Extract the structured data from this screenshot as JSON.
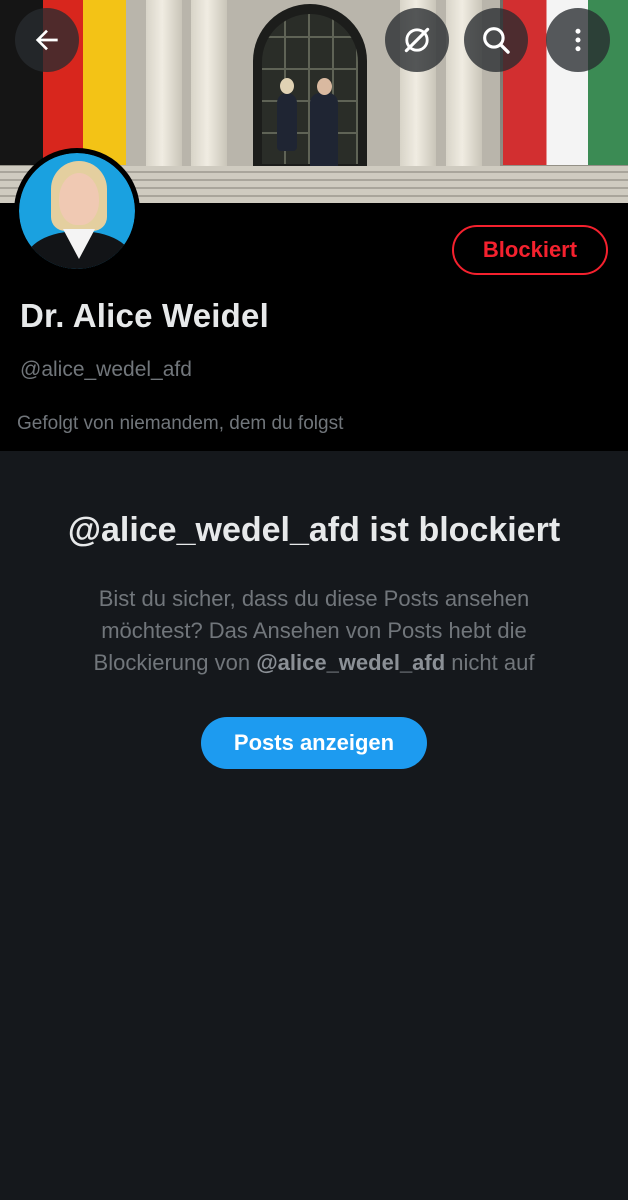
{
  "header": {
    "banner_alt": "Profile banner image",
    "back_icon": "arrow-left-icon",
    "grok_icon": "grok-icon",
    "search_icon": "search-icon",
    "more_icon": "more-vertical-icon"
  },
  "profile": {
    "display_name": "Dr. Alice Weidel",
    "handle": "@alice_wedel_afd",
    "followed_by": "Gefolgt von niemandem, dem du folgst",
    "blocked_button": "Blockiert"
  },
  "blocked_notice": {
    "title": "@alice_wedel_afd ist blockiert",
    "desc_before": "Bist du sicher, dass du diese Posts ansehen möchtest? Das Ansehen von Posts hebt die Blockierung von ",
    "desc_handle": "@alice_wedel_afd",
    "desc_after": " nicht auf",
    "show_posts_button": "Posts anzeigen"
  },
  "colors": {
    "accent_blue": "#1d9bf0",
    "blocked_red": "#f4212e",
    "background": "#15181c",
    "secondary_text": "#71767b"
  }
}
